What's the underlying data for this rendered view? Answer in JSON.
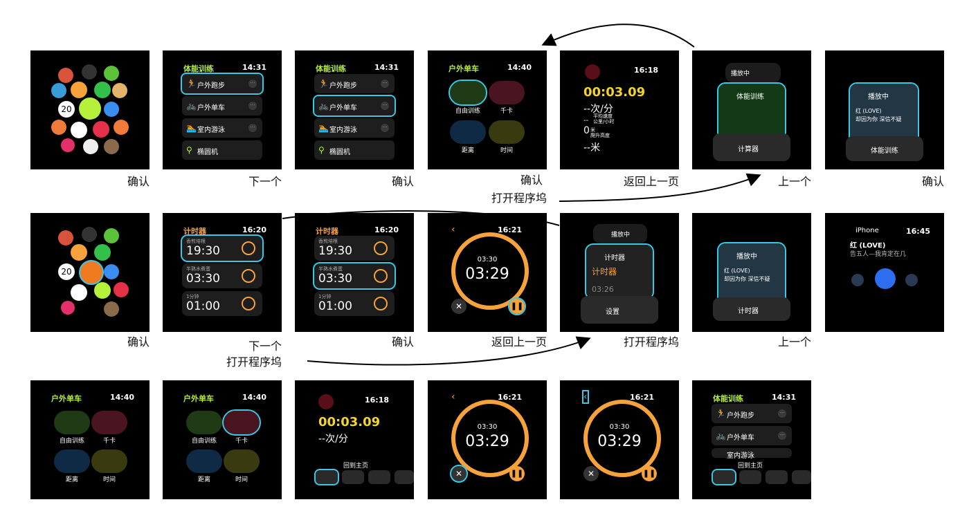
{
  "captions": {
    "r1": [
      "确认",
      "下一个",
      "确认",
      "确认",
      "返回上一页",
      "上一个",
      "确认"
    ],
    "r1_extra": "打开程序坞",
    "r2": [
      "确认",
      "下一个",
      "确认",
      "返回上一页",
      "打开程序坞",
      "上一个"
    ],
    "r2_extra": "打开程序坞"
  },
  "workout": {
    "title": "体能训练",
    "time": "14:31",
    "items": [
      "户外跑步",
      "户外单车",
      "室内游泳",
      "椭圆机"
    ]
  },
  "bike": {
    "title": "户外单车",
    "time": "14:40",
    "opts": [
      "自由训练",
      "千卡",
      "距离",
      "时间"
    ]
  },
  "session": {
    "time": "16:18",
    "elapsed": "00:03.09",
    "pace": "--次/分",
    "pace_sub1": "平均速度",
    "pace_sub2": "公里/小时",
    "dash": "--",
    "alt_val": "0",
    "alt_unit": "米",
    "alt_label": "爬升高度",
    "dist": "--米",
    "dock": "回到主页"
  },
  "dock1": {
    "np": "播放中",
    "work": "体能训练",
    "calc": "计算器"
  },
  "music": {
    "np": "播放中",
    "song": "红 (LOVE)",
    "lyric": "却因为你 深信不疑",
    "work": "体能训练"
  },
  "timers": {
    "title": "计时器",
    "time": "16:20",
    "items": [
      {
        "sub": "香煎培根",
        "val": "19:30"
      },
      {
        "sub": "半熟水煮蛋",
        "val": "03:30"
      },
      {
        "sub": "1分钟",
        "val": "01:00"
      }
    ]
  },
  "run": {
    "time": "16:21",
    "total": "03:30",
    "remain": "03:29"
  },
  "dock2": {
    "np": "播放中",
    "timer": "计时器",
    "val": "03:26",
    "settings": "设置"
  },
  "music2": {
    "np": "播放中",
    "song": "红 (LOVE)",
    "lyric": "却因为你 深信不疑",
    "timer": "计时器"
  },
  "np": {
    "src": "iPhone",
    "time": "16:45",
    "song": "红 (LOVE)",
    "artist": "告五人—我肯定在几"
  },
  "workout3": {
    "title": "体能训练",
    "time": "14:31",
    "items": [
      "户外跑步",
      "户外单车",
      "室内游泳"
    ],
    "dock": "回到主页"
  },
  "home": {
    "date": "20"
  }
}
